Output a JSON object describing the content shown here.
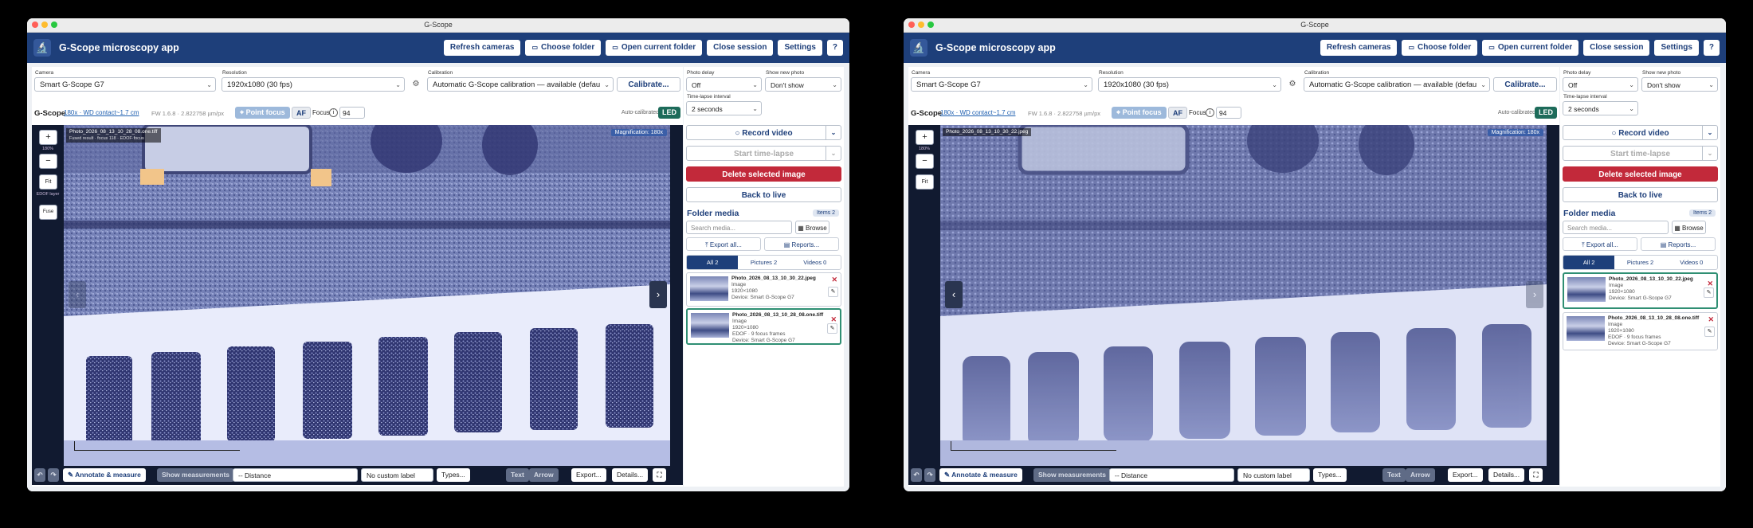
{
  "windows": [
    {
      "title": "G-Scope",
      "app_name": "G-Scope microscopy app",
      "header_buttons": [
        "Refresh cameras",
        "Choose folder",
        "Open current folder",
        "Close session",
        "Settings",
        "?"
      ],
      "camera_label": "Camera",
      "camera_value": "Smart G-Scope G7",
      "resolution_label": "Resolution",
      "resolution_value": "1920x1080 (30 fps)",
      "calibration_label": "Calibration",
      "calibration_value": "Automatic G-Scope calibration — available (defau",
      "calibrate_btn": "Calibrate...",
      "device": "G-Scope",
      "magnification_link": "180x · WD contact~1.7 cm",
      "fw_info": "FW 1.6.8 · 2.822758 µm/px",
      "point_focus": "Point focus",
      "af": "AF",
      "focus_label": "Focus",
      "focus_value": "94",
      "auto_calibrated": "Auto-calibrated",
      "led": "LED",
      "zoom_pct": "180%",
      "fit": "Fit",
      "edof_label": "EDOF layer",
      "fuse": "Fuse",
      "photo_tag": "Photo_2026_08_13_10_28_08.one.tiff",
      "photo_sub": "Fused result · focus 118 · EDOF·focus",
      "magnification_tag": "Magnification: 180x",
      "bottom": {
        "undo": "↶",
        "redo": "↷",
        "annotate": "Annotate & measure",
        "show_measurements": "Show measurements",
        "distance": "-- Distance",
        "custom_label": "No custom label",
        "types": "Types...",
        "text": "Text",
        "arrow": "Arrow",
        "export": "Export...",
        "details": "Details...",
        "expand": "⛶"
      },
      "right": {
        "photo_delay_label": "Photo delay",
        "photo_delay_value": "Off",
        "show_new_label": "Show new photo",
        "show_new_value": "Don't show",
        "timelapse_label": "Time-lapse interval",
        "timelapse_value": "2 seconds",
        "record_video": "Record video",
        "start_timelapse": "Start time-lapse",
        "delete_selected": "Delete selected image",
        "back_to_live": "Back to live",
        "folder_media": "Folder media",
        "items_badge": "Items 2",
        "search_placeholder": "Search media...",
        "browse": "Browse",
        "export_all": "Export all...",
        "reports": "Reports...",
        "tabs": [
          "All 2",
          "Pictures 2",
          "Videos 0"
        ],
        "media": [
          {
            "name": "Photo_2026_08_13_10_30_22.jpeg",
            "type": "Image",
            "res": "1920×1080",
            "extra": "",
            "device": "Device: Smart G-Scope G7"
          },
          {
            "name": "Photo_2026_08_13_10_28_08.one.tiff",
            "type": "Image",
            "res": "1920×1080",
            "extra": "EDOF · 9 focus frames",
            "device": "Device: Smart G-Scope G7"
          }
        ]
      }
    },
    {
      "title": "G-Scope",
      "app_name": "G-Scope microscopy app",
      "header_buttons": [
        "Refresh cameras",
        "Choose folder",
        "Open current folder",
        "Close session",
        "Settings",
        "?"
      ],
      "camera_label": "Camera",
      "camera_value": "Smart G-Scope G7",
      "resolution_label": "Resolution",
      "resolution_value": "1920x1080 (30 fps)",
      "calibration_label": "Calibration",
      "calibration_value": "Automatic G-Scope calibration — available (defau",
      "calibrate_btn": "Calibrate...",
      "device": "G-Scope",
      "magnification_link": "180x · WD contact~1.7 cm",
      "fw_info": "FW 1.6.8 · 2.822758 µm/px",
      "point_focus": "Point focus",
      "af": "AF",
      "focus_label": "Focus",
      "focus_value": "94",
      "auto_calibrated": "Auto-calibrated",
      "led": "LED",
      "zoom_pct": "180%",
      "fit": "Fit",
      "edof_label": "",
      "fuse": "",
      "photo_tag": "Photo_2026_08_13_10_30_22.jpeg",
      "photo_sub": "",
      "magnification_tag": "Magnification: 180x",
      "bottom": {
        "undo": "↶",
        "redo": "↷",
        "annotate": "Annotate & measure",
        "show_measurements": "Show measurements",
        "distance": "-- Distance",
        "custom_label": "No custom label",
        "types": "Types...",
        "text": "Text",
        "arrow": "Arrow",
        "export": "Export...",
        "details": "Details...",
        "expand": "⛶"
      },
      "right": {
        "photo_delay_label": "Photo delay",
        "photo_delay_value": "Off",
        "show_new_label": "Show new photo",
        "show_new_value": "Don't show",
        "timelapse_label": "Time-lapse interval",
        "timelapse_value": "2 seconds",
        "record_video": "Record video",
        "start_timelapse": "Start time-lapse",
        "delete_selected": "Delete selected image",
        "back_to_live": "Back to live",
        "folder_media": "Folder media",
        "items_badge": "Items 2",
        "search_placeholder": "Search media...",
        "browse": "Browse",
        "export_all": "Export all...",
        "reports": "Reports...",
        "tabs": [
          "All 2",
          "Pictures 2",
          "Videos 0"
        ],
        "media": [
          {
            "name": "Photo_2026_08_13_10_30_22.jpeg",
            "type": "Image",
            "res": "1920×1080",
            "extra": "",
            "device": "Device: Smart G-Scope G7"
          },
          {
            "name": "Photo_2026_08_13_10_28_08.one.tiff",
            "type": "Image",
            "res": "1920×1080",
            "extra": "EDOF · 9 focus frames",
            "device": "Device: Smart G-Scope G7"
          }
        ]
      }
    }
  ]
}
